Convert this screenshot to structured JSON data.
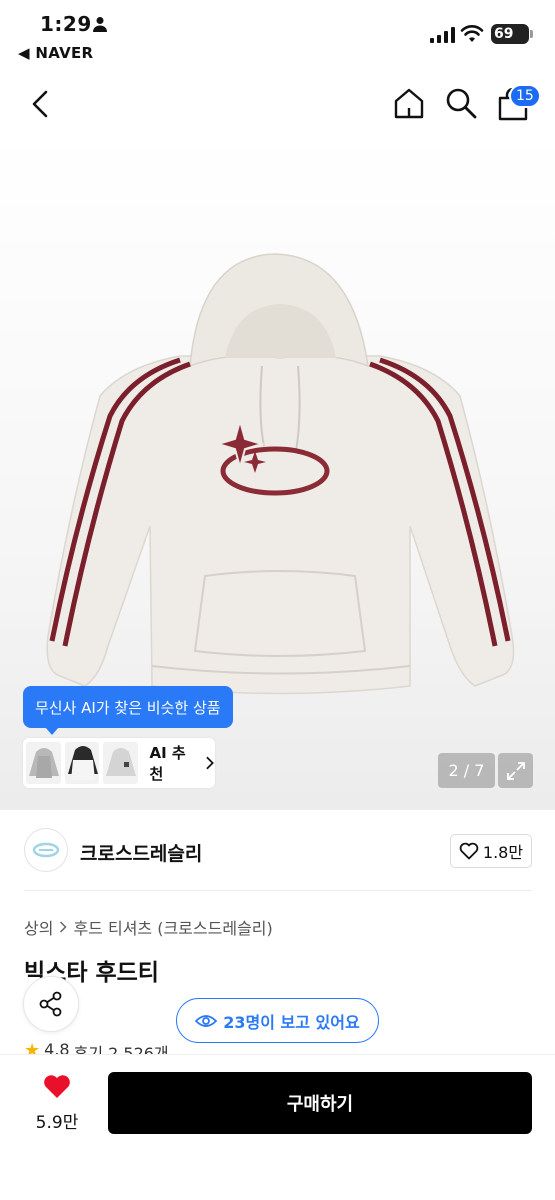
{
  "status_bar": {
    "time": "1:29",
    "back_app": "◀ NAVER",
    "battery": "69"
  },
  "header": {
    "cart_count": "15"
  },
  "gallery": {
    "ai_tooltip": "무신사 AI가 찾은 비슷한 상품",
    "ai_label": "AI 추천",
    "pager": "2 / 7"
  },
  "brand": {
    "name": "크로스드레슬리",
    "likes": "1.8만"
  },
  "breadcrumb": {
    "category": "상의",
    "subcategory": "후드 티셔츠 (크로스드레슬리)"
  },
  "product": {
    "title": "빅스타 후드티",
    "viewers": "23명이 보고 있어요",
    "rating": "4.8",
    "reviews": "후기 2,526개"
  },
  "bottom_bar": {
    "wish_count": "5.9만",
    "buy_label": "구매하기"
  },
  "colors": {
    "accent": "#2a7af7",
    "badge": "#1b6bf5",
    "heart": "#e8102a",
    "stripe": "#7a1f2b"
  }
}
